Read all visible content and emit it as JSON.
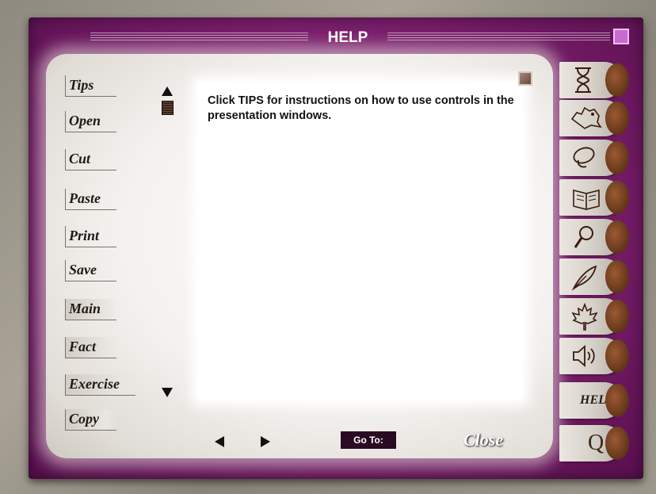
{
  "window": {
    "title": "HELP"
  },
  "menu": {
    "items": [
      {
        "label": "Tips"
      },
      {
        "label": "Open"
      },
      {
        "label": "Cut"
      },
      {
        "label": "Paste"
      },
      {
        "label": "Print"
      },
      {
        "label": "Save"
      },
      {
        "label": "Main"
      },
      {
        "label": "Fact"
      },
      {
        "label": "Exercise"
      },
      {
        "label": "Copy"
      }
    ]
  },
  "content": {
    "text": "Click TIPS for instructions on how to use controls in the presentation windows."
  },
  "bottom": {
    "goto_label": "Go To:",
    "close_label": "Close"
  },
  "tabs": [
    {
      "icon": "hourglass-icon"
    },
    {
      "icon": "canada-map-icon"
    },
    {
      "icon": "lasso-icon"
    },
    {
      "icon": "open-book-icon"
    },
    {
      "icon": "magnifier-icon"
    },
    {
      "icon": "quill-icon"
    },
    {
      "icon": "maple-leaf-icon"
    },
    {
      "icon": "speaker-icon"
    },
    {
      "label": "HELP"
    },
    {
      "label": "Q"
    }
  ]
}
